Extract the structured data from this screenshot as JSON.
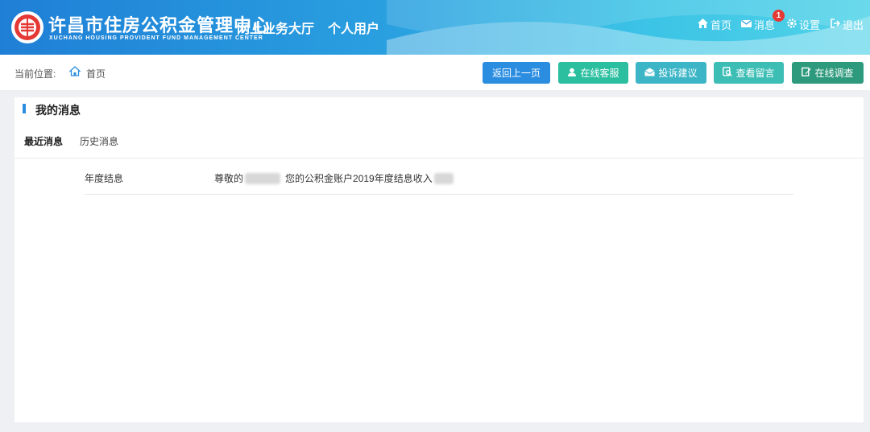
{
  "header": {
    "brand_title": "许昌市住房公积金管理中心",
    "brand_subtitle": "XUCHANG HOUSING PROVIDENT FUND MANAGEMENT CENTER",
    "hall": "网上业务大厅",
    "personal": "个人用户",
    "nav": {
      "home": "首页",
      "messages": "消息",
      "messages_badge": "1",
      "settings": "设置",
      "logout": "退出"
    }
  },
  "location": {
    "label": "当前位置:",
    "home": "首页"
  },
  "actions": {
    "back": "返回上一页",
    "service": "在线客服",
    "complaint": "投诉建议",
    "view_messages": "查看留言",
    "survey": "在线调查"
  },
  "panel": {
    "title": "我的消息",
    "tabs": [
      "最近消息",
      "历史消息"
    ],
    "messages": [
      {
        "type": "年度结息",
        "prefix": "尊敬的",
        "body": "您的公积金账户2019年度结息收入"
      }
    ]
  },
  "colors": {
    "primary": "#2b8de0",
    "badge": "#e53935"
  }
}
